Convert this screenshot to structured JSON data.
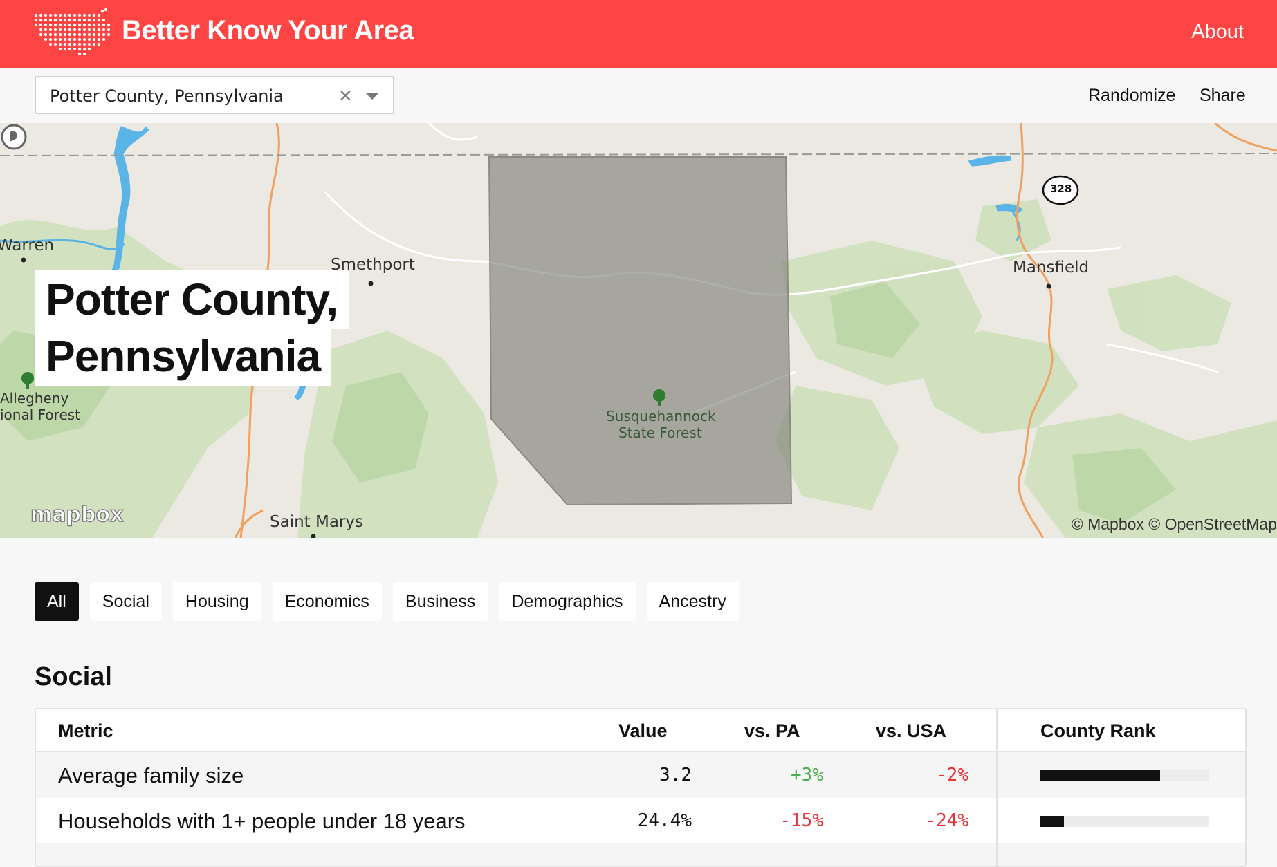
{
  "header": {
    "title": "Better Know Your Area",
    "about_label": "About",
    "brand_color": "#ff4444"
  },
  "toolbar": {
    "search_value": "Potter County, Pennsylvania",
    "clear_icon": "×",
    "randomize_label": "Randomize",
    "share_label": "Share"
  },
  "map": {
    "title_line1": "Potter County,",
    "title_line2": "Pennsylvania",
    "labels": {
      "warren": "Warren",
      "smethport": "Smethport",
      "mansfield": "Mansfield",
      "allegheny_line1": "Allegheny",
      "allegheny_line2": "ional Forest",
      "susq_line1": "Susquehannock",
      "susq_line2": "State Forest",
      "saint_marys": "Saint Marys",
      "route": "328"
    },
    "logo_text": "mapbox",
    "attribution": "© Mapbox © OpenStreetMap"
  },
  "tabs": [
    {
      "label": "All",
      "active": true
    },
    {
      "label": "Social",
      "active": false
    },
    {
      "label": "Housing",
      "active": false
    },
    {
      "label": "Economics",
      "active": false
    },
    {
      "label": "Business",
      "active": false
    },
    {
      "label": "Demographics",
      "active": false
    },
    {
      "label": "Ancestry",
      "active": false
    }
  ],
  "section": {
    "title": "Social",
    "columns": {
      "metric": "Metric",
      "value": "Value",
      "vs_state": "vs. PA",
      "vs_usa": "vs. USA",
      "rank": "County Rank"
    },
    "rows": [
      {
        "metric": "Average family size",
        "value": "3.2",
        "vs_state": "+3%",
        "vs_usa": "-2%",
        "rank_fraction": 0.71
      },
      {
        "metric": "Households with 1+ people under 18 years",
        "value": "24.4%",
        "vs_state": "-15%",
        "vs_usa": "-24%",
        "rank_fraction": 0.14
      }
    ]
  }
}
